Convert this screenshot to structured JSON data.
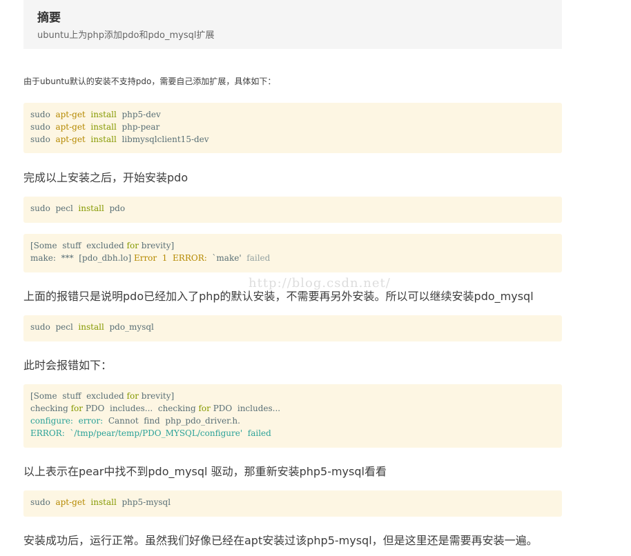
{
  "summary": {
    "title": "摘要",
    "text": "ubuntu上为php添加pdo和pdo_mysql扩展"
  },
  "paragraphs": {
    "p1": "由于ubuntu默认的安装不支持pdo，需要自己添加扩展，具体如下：",
    "p2": "完成以上安装之后，开始安装pdo",
    "p3": "上面的报错只是说明pdo已经加入了php的默认安装，不需要再另外安装。所以可以继续安装pdo_mysql",
    "p4": "此时会报错如下：",
    "p5": "以上表示在pear中找不到pdo_mysql 驱动，那重新安装php5-mysql看看",
    "p6": "安装成功后，运行正常。虽然我们好像已经在apt安装过该php5-mysql，但是这里还是需要再安装一遍。"
  },
  "watermark": "http://blog.csdn.net/",
  "code_blocks": {
    "b1": {
      "l1": {
        "cmd": "sudo",
        "sub": "apt-get",
        "kw": "install",
        "arg": "php5-dev"
      },
      "l2": {
        "cmd": "sudo",
        "sub": "apt-get",
        "kw": "install",
        "arg": "php-pear"
      },
      "l3": {
        "cmd": "sudo",
        "sub": "apt-get",
        "kw": "install",
        "arg": "libmysqlclient15-dev"
      }
    },
    "b2": {
      "cmd": "sudo",
      "sub": "pecl",
      "kw": "install",
      "arg": "pdo"
    },
    "b3": {
      "l1a": "[Some  stuff  excluded ",
      "l1kw": "for",
      "l1b": " brevity]",
      "l2a": "make:  ***  [pdo_dbh.lo] ",
      "l2err": "Error  1  ERROR:",
      "l2b": "  `make'  ",
      "l2c": "failed"
    },
    "b4": {
      "cmd": "sudo",
      "sub": "pecl",
      "kw": "install",
      "arg": "pdo_mysql"
    },
    "b5": {
      "l1a": "[Some  stuff  excluded ",
      "l1kw": "for",
      "l1b": " brevity]",
      "l2a": "checking ",
      "l2kw": "for",
      "l2b": " PDO  includes...  checking ",
      "l2kw2": "for",
      "l2c": " PDO  includes...",
      "l3a": "configure:  error:",
      "l3b": "  Cannot  find  php_pdo_driver.h.",
      "l4a": "ERROR:",
      "l4b": "  `/tmp/pear/temp/PDO_MYSQL/configure'  ",
      "l4c": "failed"
    },
    "b6": {
      "cmd": "sudo",
      "sub": "apt-get",
      "kw": "install",
      "arg": "php5-mysql"
    }
  }
}
